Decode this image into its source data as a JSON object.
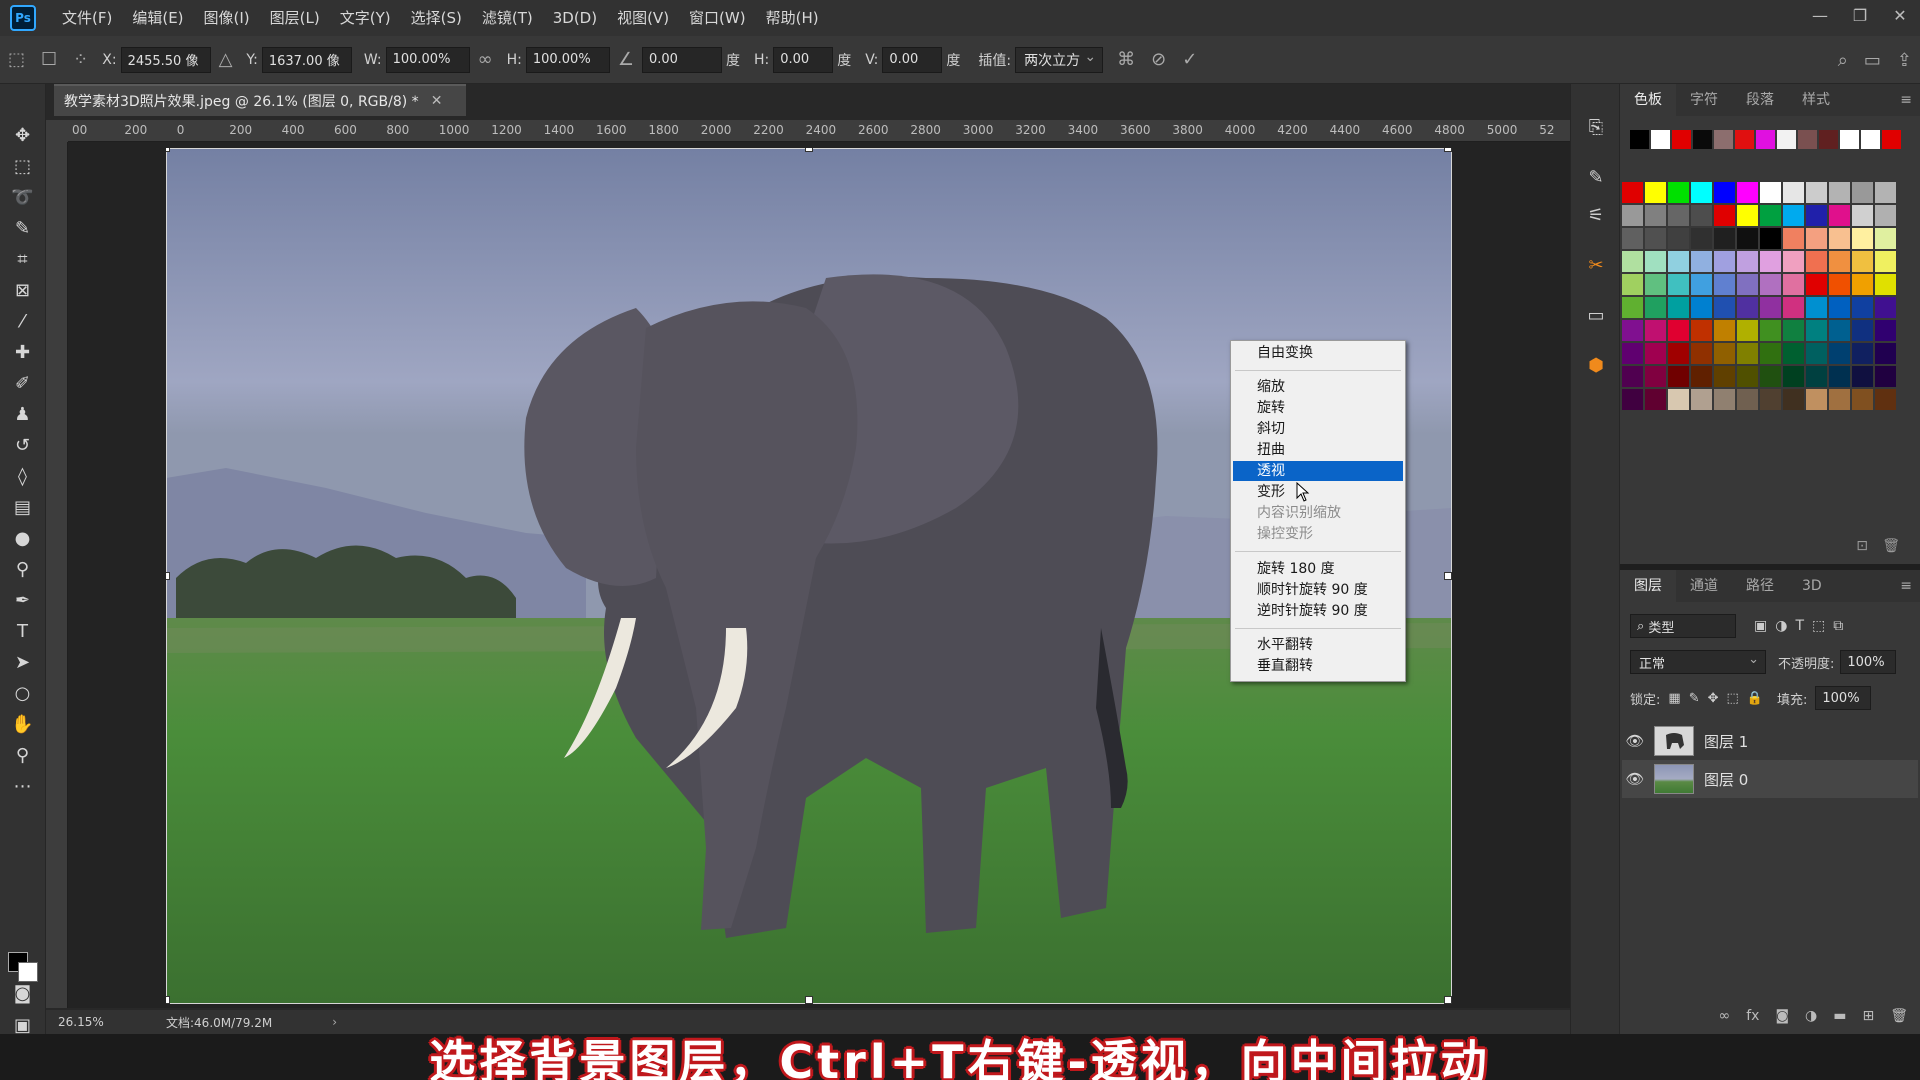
{
  "menubar": {
    "logo": "Ps",
    "items": [
      "文件(F)",
      "编辑(E)",
      "图像(I)",
      "图层(L)",
      "文字(Y)",
      "选择(S)",
      "滤镜(T)",
      "3D(D)",
      "视图(V)",
      "窗口(W)",
      "帮助(H)"
    ]
  },
  "options": {
    "x_label": "X:",
    "x_value": "2455.50 像",
    "y_label": "Y:",
    "y_value": "1637.00 像",
    "w_label": "W:",
    "w_value": "100.00%",
    "h_label": "H:",
    "h_value": "100.00%",
    "angle_value": "0.00",
    "angle_unit": "度",
    "hskew_label": "H:",
    "hskew_value": "0.00",
    "hskew_unit": "度",
    "vskew_label": "V:",
    "vskew_value": "0.00",
    "vskew_unit": "度",
    "interp_label": "插值:",
    "interp_value": "两次立方"
  },
  "document": {
    "tab_title": "教学素材3D照片效果.jpeg @ 26.1% (图层 0, RGB/8) *",
    "ruler_ticks": [
      "00",
      "200",
      "0",
      "200",
      "400",
      "600",
      "800",
      "1000",
      "1200",
      "1400",
      "1600",
      "1800",
      "2000",
      "2200",
      "2400",
      "2600",
      "2800",
      "3000",
      "3200",
      "3400",
      "3600",
      "3800",
      "4000",
      "4200",
      "4400",
      "4600",
      "4800",
      "5000",
      "52"
    ]
  },
  "status": {
    "zoom": "26.15%",
    "doc_size": "文档:46.0M/79.2M"
  },
  "context_menu": {
    "free_transform": "自由变换",
    "scale": "缩放",
    "rotate": "旋转",
    "skew": "斜切",
    "distort": "扭曲",
    "perspective": "透视",
    "warp": "变形",
    "content_aware": "内容识别缩放",
    "puppet": "操控变形",
    "rotate180": "旋转 180 度",
    "rotate_cw": "顺时针旋转 90 度",
    "rotate_ccw": "逆时针旋转 90 度",
    "flip_h": "水平翻转",
    "flip_v": "垂直翻转"
  },
  "swatches_panel": {
    "tabs": [
      "色板",
      "字符",
      "段落",
      "样式"
    ],
    "top_row": [
      "#000000",
      "#ffffff",
      "#e00000",
      "#0a0a0a",
      "#8c6e6e",
      "#e01010",
      "#e010e0",
      "#f2f2f2",
      "#7a5050",
      "#602020",
      "#ffffff",
      "#ffffff",
      "#e00000"
    ],
    "grid": [
      "#e00000",
      "#ffff00",
      "#00e000",
      "#00ffff",
      "#0000ff",
      "#ff00ff",
      "#ffffff",
      "#e6e6e6",
      "#cccccc",
      "#b3b3b3",
      "#999999",
      "#b3b3b3",
      "#999999",
      "#808080",
      "#666666",
      "#4d4d4d",
      "#e00000",
      "#ffff00",
      "#00a040",
      "#00aaee",
      "#2020aa",
      "#e0108c",
      "#d0d0d0",
      "#b0b0b0",
      "#606060",
      "#505050",
      "#404040",
      "#303030",
      "#202020",
      "#101010",
      "#000000",
      "#f08060",
      "#f4a080",
      "#f8c090",
      "#fff0a0",
      "#e0f0a0",
      "#b0e0a0",
      "#a0e0c0",
      "#90d0e0",
      "#90b0e0",
      "#a0a0e0",
      "#c0a0e0",
      "#e0a0e0",
      "#f0a0c0",
      "#f07050",
      "#f09040",
      "#f0c040",
      "#f0f060",
      "#a0d060",
      "#60c080",
      "#40c0c0",
      "#40a0e0",
      "#6080d0",
      "#8070c0",
      "#b070c0",
      "#e070a0",
      "#e00000",
      "#f05000",
      "#f0a000",
      "#e0e000",
      "#60b030",
      "#20a060",
      "#00a0a0",
      "#0080d0",
      "#2050b0",
      "#5030a0",
      "#9030a0",
      "#d03080",
      "#0090d0",
      "#0060c0",
      "#1040a0",
      "#401090",
      "#801090",
      "#c01070",
      "#e00030",
      "#c03000",
      "#c08000",
      "#b0b000",
      "#409020",
      "#108040",
      "#008080",
      "#006090",
      "#103080",
      "#300070",
      "#600070",
      "#a00050",
      "#a00000",
      "#903000",
      "#906000",
      "#808000",
      "#307010",
      "#006030",
      "#006060",
      "#004070",
      "#102060",
      "#200050",
      "#500050",
      "#800040",
      "#700000",
      "#602000",
      "#604000",
      "#505000",
      "#205010",
      "#004020",
      "#004040",
      "#003050",
      "#101040",
      "#200040",
      "#400040",
      "#600030",
      "#d8c8b0",
      "#b0a090",
      "#908070",
      "#706050",
      "#504030",
      "#403020",
      "#c09060",
      "#a07040",
      "#805020",
      "#603010"
    ]
  },
  "layers_panel": {
    "tabs": [
      "图层",
      "通道",
      "路径",
      "3D"
    ],
    "filter_kind": "类型",
    "blend_mode": "正常",
    "opacity_label": "不透明度:",
    "opacity_value": "100%",
    "lock_label": "锁定:",
    "fill_label": "填充:",
    "fill_value": "100%",
    "layers": [
      {
        "name": "图层 1"
      },
      {
        "name": "图层 0"
      }
    ]
  },
  "subtitle": "选择背景图层，Ctrl+T右键-透视，向中间拉动"
}
